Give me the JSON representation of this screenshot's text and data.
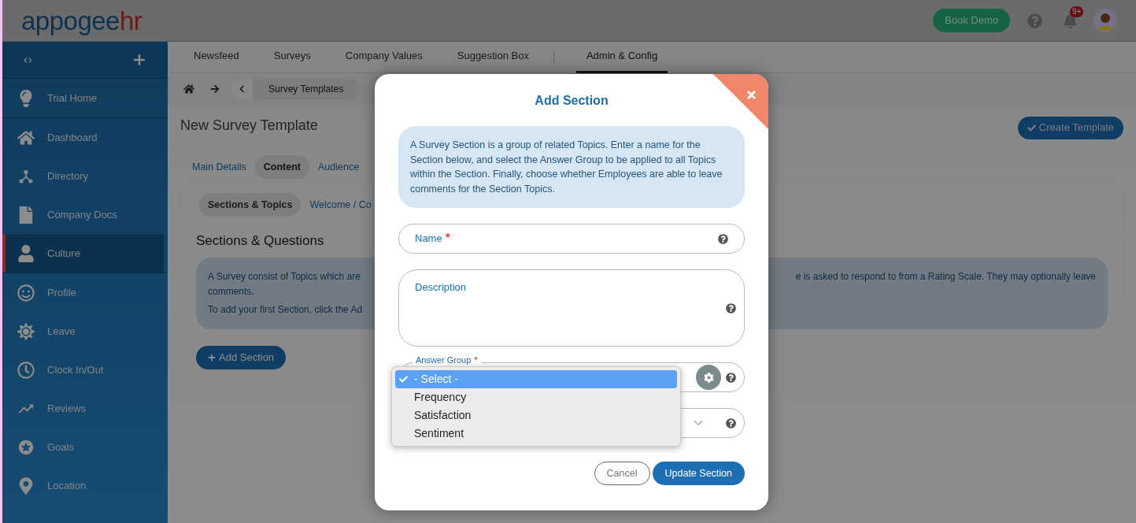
{
  "header": {
    "logo": {
      "main": "appogee",
      "accent": "hr"
    },
    "book_demo": "Book Demo",
    "notification_badge": "9+"
  },
  "sidebar": {
    "groups": [
      [
        {
          "label": "Trial Home",
          "selected": false
        }
      ],
      [
        {
          "label": "Dashboard",
          "selected": false
        },
        {
          "label": "Directory",
          "selected": false
        },
        {
          "label": "Company Docs",
          "selected": false
        },
        {
          "label": "Culture",
          "selected": true
        }
      ],
      [
        {
          "label": "Profile",
          "selected": false
        },
        {
          "label": "Leave",
          "selected": false
        },
        {
          "label": "Clock In/Out",
          "selected": false
        },
        {
          "label": "Reviews",
          "selected": false
        },
        {
          "label": "Goals",
          "selected": false
        },
        {
          "label": "Location",
          "selected": false
        }
      ]
    ]
  },
  "top_nav": {
    "tabs": [
      {
        "label": "Newsfeed",
        "selected": false
      },
      {
        "label": "Surveys",
        "selected": false
      },
      {
        "label": "Company Values",
        "selected": false
      },
      {
        "label": "Suggestion Box",
        "selected": false
      },
      {
        "label": "Admin & Config",
        "selected": true
      }
    ]
  },
  "breadcrumb": {
    "items": [
      "Survey Templates"
    ]
  },
  "page": {
    "title": "New Survey Template",
    "create_button": "Create Template",
    "tabs": [
      {
        "label": "Main Details",
        "selected": false
      },
      {
        "label": "Content",
        "selected": true
      },
      {
        "label": "Audience",
        "selected": false
      }
    ],
    "sub_tabs": [
      {
        "label": "Sections & Topics",
        "selected": true
      },
      {
        "label": "Welcome / Co",
        "selected": false
      }
    ],
    "heading": "Sections & Questions",
    "info": {
      "line1_left": "A Survey consist of Topics which are",
      "line1_right": "e is asked to respond to from a Rating Scale. They may optionally leave",
      "line2": "comments.",
      "line3": "To add your first Section, click the Ad"
    },
    "add_button": "Add Section"
  },
  "modal": {
    "title": "Add Section",
    "intro": "A Survey Section is a group of related Topics. Enter a name for the Section below, and select the Answer Group to be applied to all Topics within the Section. Finally, choose whether Employees are able to leave comments for the Section Topics.",
    "fields": [
      {
        "kind": "text",
        "label": "Name",
        "required_mark": "*"
      },
      {
        "kind": "textarea",
        "label": "Description"
      },
      {
        "kind": "dropdown",
        "label": "Answer Group",
        "required_mark": "*",
        "options": [
          {
            "label": "- Select -",
            "selected": true
          },
          {
            "label": "Frequency",
            "selected": false
          },
          {
            "label": "Satisfaction",
            "selected": false
          },
          {
            "label": "Sentiment",
            "selected": false
          }
        ]
      },
      {
        "kind": "select"
      }
    ],
    "cancel": "Cancel",
    "submit": "Update Section"
  }
}
